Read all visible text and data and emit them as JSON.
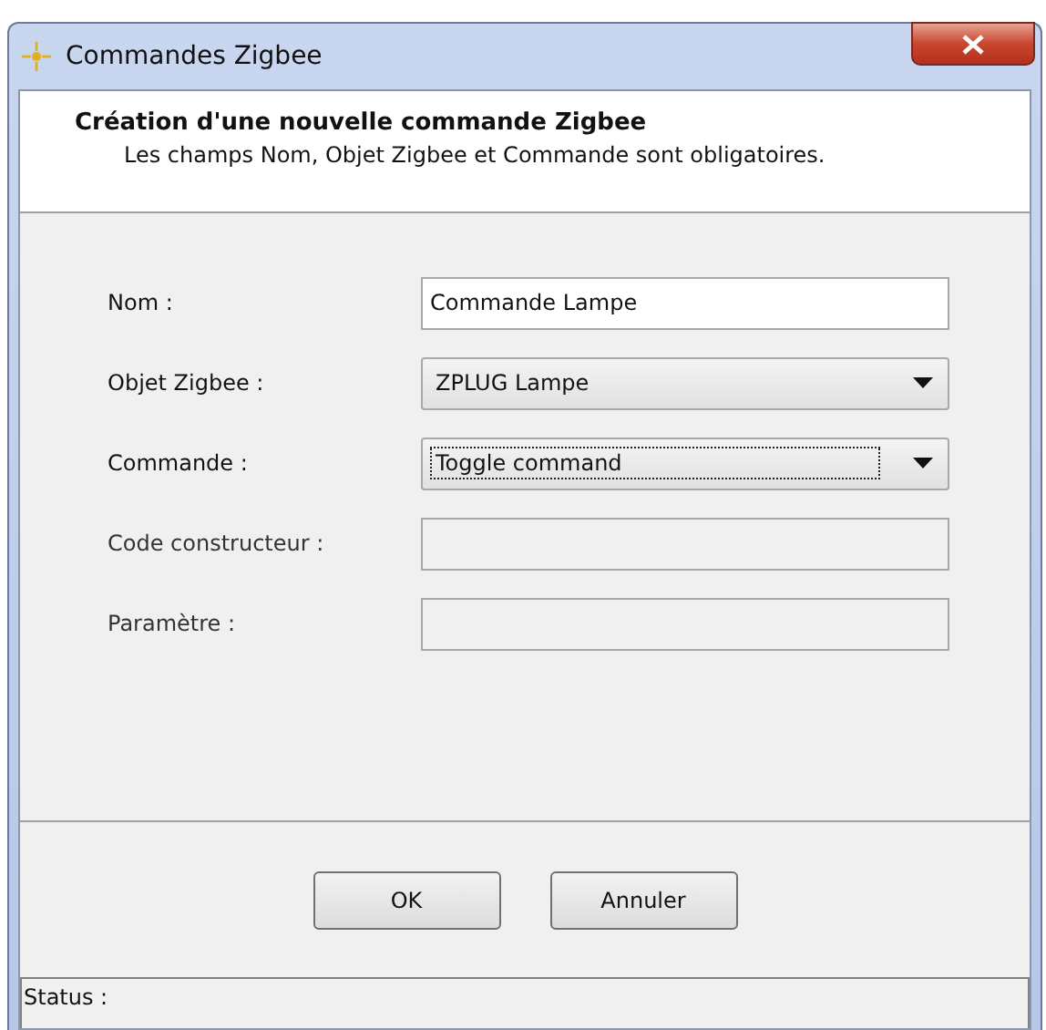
{
  "window": {
    "title": "Commandes Zigbee"
  },
  "header": {
    "title": "Création d'une nouvelle commande Zigbee",
    "subtitle": "Les champs Nom, Objet Zigbee et Commande sont obligatoires."
  },
  "fields": [
    {
      "label": "Nom :",
      "kind": "text",
      "value": "Commande Lampe",
      "disabled": false,
      "focused": false
    },
    {
      "label": "Objet Zigbee :",
      "kind": "dropdown",
      "value": "ZPLUG Lampe",
      "disabled": false,
      "focused": false
    },
    {
      "label": "Commande :",
      "kind": "dropdown",
      "value": "Toggle command",
      "disabled": false,
      "focused": true
    },
    {
      "label": "Code constructeur :",
      "kind": "text",
      "disabled": true,
      "focused": false
    },
    {
      "label": "Paramètre :",
      "kind": "text",
      "disabled": true,
      "focused": false
    }
  ],
  "buttons": [
    "OK",
    "Annuler"
  ],
  "status_bar": {
    "text": "Status :"
  }
}
